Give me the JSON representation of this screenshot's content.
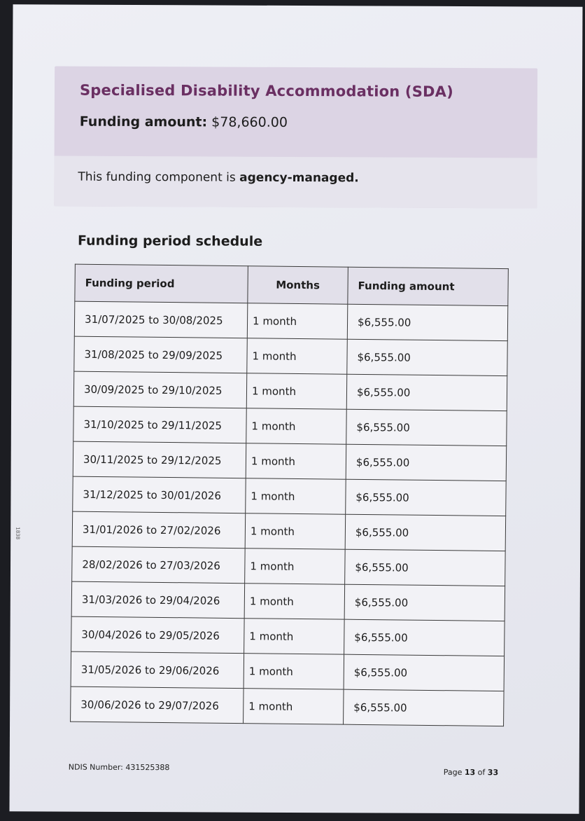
{
  "summary": {
    "title": "Specialised Disability Accommodation (SDA)",
    "funding_label": "Funding amount:",
    "funding_value": "$78,660.00",
    "managed_prefix": "This funding component is ",
    "managed_value": "agency-managed."
  },
  "schedule": {
    "title": "Funding period schedule",
    "headers": [
      "Funding period",
      "Months",
      "Funding amount"
    ],
    "rows": [
      [
        "31/07/2025 to 30/08/2025",
        "1 month",
        "$6,555.00"
      ],
      [
        "31/08/2025 to 29/09/2025",
        "1 month",
        "$6,555.00"
      ],
      [
        "30/09/2025 to 29/10/2025",
        "1 month",
        "$6,555.00"
      ],
      [
        "31/10/2025 to 29/11/2025",
        "1 month",
        "$6,555.00"
      ],
      [
        "30/11/2025 to 29/12/2025",
        "1 month",
        "$6,555.00"
      ],
      [
        "31/12/2025 to 30/01/2026",
        "1 month",
        "$6,555.00"
      ],
      [
        "31/01/2026 to 27/02/2026",
        "1 month",
        "$6,555.00"
      ],
      [
        "28/02/2026 to 27/03/2026",
        "1 month",
        "$6,555.00"
      ],
      [
        "31/03/2026 to 29/04/2026",
        "1 month",
        "$6,555.00"
      ],
      [
        "30/04/2026 to 29/05/2026",
        "1 month",
        "$6,555.00"
      ],
      [
        "31/05/2026 to 29/06/2026",
        "1 month",
        "$6,555.00"
      ],
      [
        "30/06/2026 to 29/07/2026",
        "1 month",
        "$6,555.00"
      ]
    ]
  },
  "footer": {
    "ndis_number": "NDIS Number: 431525388",
    "page_prefix": "Page ",
    "page_current": "13",
    "page_sep": " of ",
    "page_total": "33"
  },
  "margin_code": "1838"
}
